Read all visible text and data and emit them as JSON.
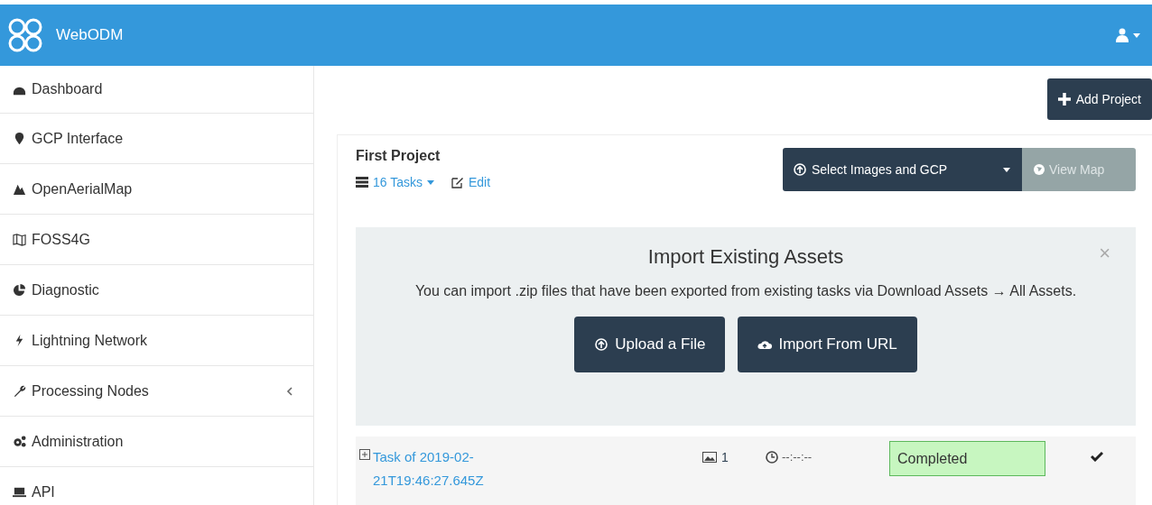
{
  "navbar": {
    "brand": "WebODM"
  },
  "sidebar": {
    "items": [
      {
        "label": "Dashboard",
        "has_submenu": false
      },
      {
        "label": "GCP Interface",
        "has_submenu": false
      },
      {
        "label": "OpenAerialMap",
        "has_submenu": false
      },
      {
        "label": "FOSS4G",
        "has_submenu": false
      },
      {
        "label": "Diagnostic",
        "has_submenu": false
      },
      {
        "label": "Lightning Network",
        "has_submenu": false
      },
      {
        "label": "Processing Nodes",
        "has_submenu": true
      },
      {
        "label": "Administration",
        "has_submenu": false
      },
      {
        "label": "API",
        "has_submenu": false
      }
    ]
  },
  "add_project_button": "Add Project",
  "project": {
    "title": "First Project",
    "tasks_link": "16 Tasks",
    "edit_link": "Edit",
    "select_button": "Select Images and GCP",
    "view_map_button": {
      "label": "View Map",
      "disabled": true
    },
    "import_panel": {
      "title": "Import Existing Assets",
      "close": "×",
      "text": "You can import .zip files that have been exported from existing tasks via Download Assets → All Assets.",
      "buttons": [
        "Upload a File",
        "Import From URL"
      ]
    },
    "tasks": [
      {
        "name": "Task of 2019-02-21T19:46:27.645Z",
        "images": "1",
        "duration": "--:--:--",
        "status": "Completed",
        "color": "#c7f6c0",
        "done": true
      }
    ]
  }
}
